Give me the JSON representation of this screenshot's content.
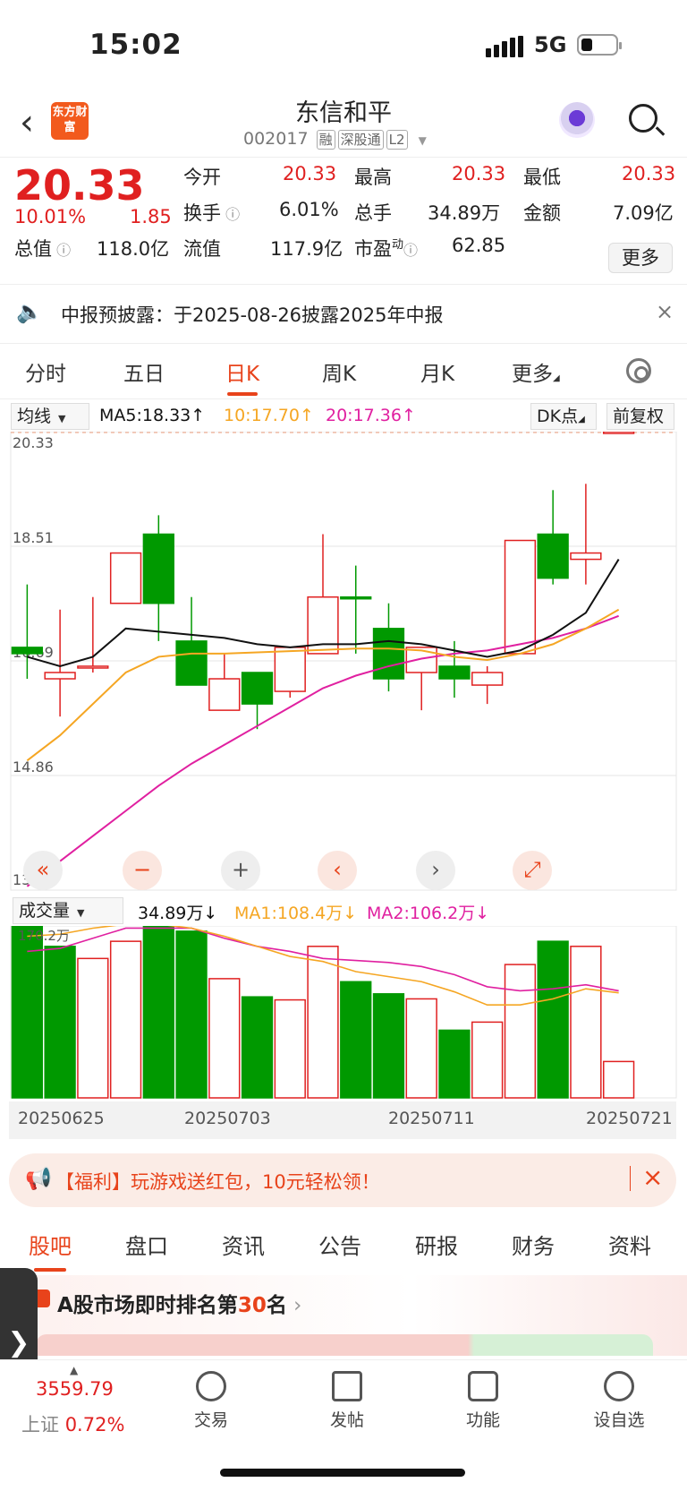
{
  "status": {
    "time": "15:02",
    "network": "5G"
  },
  "header": {
    "logo": "东方财富",
    "stock_name": "东信和平",
    "code": "002017",
    "tags": [
      "融",
      "深股通",
      "L2"
    ]
  },
  "quote": {
    "price": "20.33",
    "change_pct": "10.01%",
    "change": "1.85",
    "open_label": "今开",
    "open": "20.33",
    "high_label": "最高",
    "high": "20.33",
    "low_label": "最低",
    "low": "20.33",
    "turnover_label": "换手",
    "turnover": "6.01%",
    "volume_label": "总手",
    "volume": "34.89万",
    "amount_label": "金额",
    "amount": "7.09亿",
    "mktcap_label": "总值",
    "mktcap": "118.0亿",
    "float_label": "流值",
    "float": "117.9亿",
    "pe_label": "市盈",
    "pe_sup": "动",
    "pe": "62.85",
    "more": "更多"
  },
  "notice": {
    "text": "中报预披露：于2025-08-26披露2025年中报"
  },
  "tabs": [
    "分时",
    "五日",
    "日K",
    "周K",
    "月K",
    "更多"
  ],
  "chart_controls": {
    "ma_select": "均线",
    "ma5": "MA5:18.33↑",
    "ma10": "10:17.70↑",
    "ma20": "20:17.36↑",
    "dk": "DK点",
    "adjust": "前复权",
    "vol_select": "成交量",
    "vol_value": "34.89万↓",
    "vol_ma1": "MA1:108.4万↓",
    "vol_ma2": "MA2:106.2万↓",
    "vol_axis": "170.2万"
  },
  "colors": {
    "up": "#e02020",
    "down": "#009900",
    "ma5": "#111111",
    "ma10": "#f5a623",
    "ma20": "#e020a0",
    "accent": "#e8431b"
  },
  "chart_data": {
    "type": "candlestick",
    "ylim": [
      13.04,
      20.33
    ],
    "yticks": [
      "20.33",
      "18.51",
      "16.69",
      "14.86",
      "13.04"
    ],
    "dates_shown": [
      "20250625",
      "20250703",
      "20250711",
      "20250721"
    ],
    "candles": [
      {
        "o": 16.9,
        "c": 16.8,
        "h": 17.9,
        "l": 16.4,
        "up": false
      },
      {
        "o": 16.4,
        "c": 16.5,
        "h": 17.5,
        "l": 15.8,
        "up": true
      },
      {
        "o": 16.6,
        "c": 16.6,
        "h": 17.7,
        "l": 16.5,
        "up": true
      },
      {
        "o": 17.6,
        "c": 18.4,
        "h": 18.4,
        "l": 17.6,
        "up": true
      },
      {
        "o": 18.7,
        "c": 17.6,
        "h": 19.0,
        "l": 17.0,
        "up": false
      },
      {
        "o": 17.0,
        "c": 16.3,
        "h": 17.7,
        "l": 16.3,
        "up": false
      },
      {
        "o": 15.9,
        "c": 16.4,
        "h": 16.8,
        "l": 15.9,
        "up": true
      },
      {
        "o": 16.5,
        "c": 16.0,
        "h": 16.5,
        "l": 15.6,
        "up": false
      },
      {
        "o": 16.2,
        "c": 16.9,
        "h": 16.9,
        "l": 16.1,
        "up": true
      },
      {
        "o": 16.8,
        "c": 17.7,
        "h": 18.7,
        "l": 16.8,
        "up": true
      },
      {
        "o": 17.7,
        "c": 17.7,
        "h": 18.2,
        "l": 16.8,
        "up": false
      },
      {
        "o": 17.2,
        "c": 16.4,
        "h": 17.6,
        "l": 16.2,
        "up": false
      },
      {
        "o": 16.5,
        "c": 16.9,
        "h": 16.9,
        "l": 15.9,
        "up": true
      },
      {
        "o": 16.6,
        "c": 16.4,
        "h": 17.0,
        "l": 16.1,
        "up": false
      },
      {
        "o": 16.3,
        "c": 16.5,
        "h": 16.6,
        "l": 16.0,
        "up": true
      },
      {
        "o": 16.8,
        "c": 18.6,
        "h": 18.6,
        "l": 16.8,
        "up": true
      },
      {
        "o": 18.7,
        "c": 18.0,
        "h": 19.4,
        "l": 17.9,
        "up": false
      },
      {
        "o": 18.3,
        "c": 18.4,
        "h": 19.5,
        "l": 17.9,
        "up": true
      },
      {
        "o": 20.33,
        "c": 20.33,
        "h": 20.33,
        "l": 20.33,
        "up": true
      }
    ],
    "ma5": [
      16.75,
      16.6,
      16.75,
      17.2,
      17.15,
      17.1,
      17.05,
      16.95,
      16.9,
      16.95,
      16.95,
      17.0,
      16.95,
      16.85,
      16.75,
      16.85,
      17.1,
      17.45,
      18.3
    ],
    "ma10": [
      15.1,
      15.5,
      16.0,
      16.5,
      16.75,
      16.8,
      16.8,
      16.82,
      16.84,
      16.86,
      16.88,
      16.88,
      16.85,
      16.75,
      16.7,
      16.8,
      16.95,
      17.2,
      17.5
    ],
    "ma20": [
      13.1,
      13.5,
      13.9,
      14.3,
      14.7,
      15.05,
      15.35,
      15.65,
      15.95,
      16.25,
      16.45,
      16.6,
      16.72,
      16.8,
      16.85,
      16.95,
      17.05,
      17.2,
      17.4
    ],
    "volume": {
      "ylim": [
        0,
        170.2
      ],
      "bars": [
        170,
        150,
        138,
        155,
        170,
        165,
        118,
        100,
        97,
        150,
        115,
        103,
        98,
        67,
        75,
        132,
        155,
        150,
        36
      ],
      "up": [
        false,
        false,
        true,
        true,
        false,
        false,
        true,
        false,
        true,
        true,
        false,
        false,
        true,
        false,
        true,
        true,
        false,
        true,
        true
      ],
      "ma1": [
        160,
        162,
        168,
        172,
        172,
        168,
        160,
        150,
        140,
        135,
        125,
        120,
        115,
        105,
        92,
        92,
        98,
        108,
        104
      ],
      "ma2": [
        145,
        148,
        158,
        168,
        168,
        168,
        158,
        150,
        145,
        138,
        136,
        134,
        130,
        122,
        110,
        106,
        108,
        112,
        106
      ]
    }
  },
  "chart_buttons": [
    "«",
    "−",
    "+",
    "‹",
    "›",
    "⤢"
  ],
  "promo": {
    "text": "【福利】玩游戏送红包，10元轻松领！"
  },
  "content_tabs": [
    "股吧",
    "盘口",
    "资讯",
    "公告",
    "研报",
    "财务",
    "资料"
  ],
  "rank": {
    "prefix": "A股市场即时排名第",
    "num": "30",
    "suffix": "名"
  },
  "index": {
    "value": "3559.79",
    "name": "上证",
    "pct": "0.72%"
  },
  "bottom_nav": [
    "交易",
    "发帖",
    "功能",
    "设自选"
  ]
}
